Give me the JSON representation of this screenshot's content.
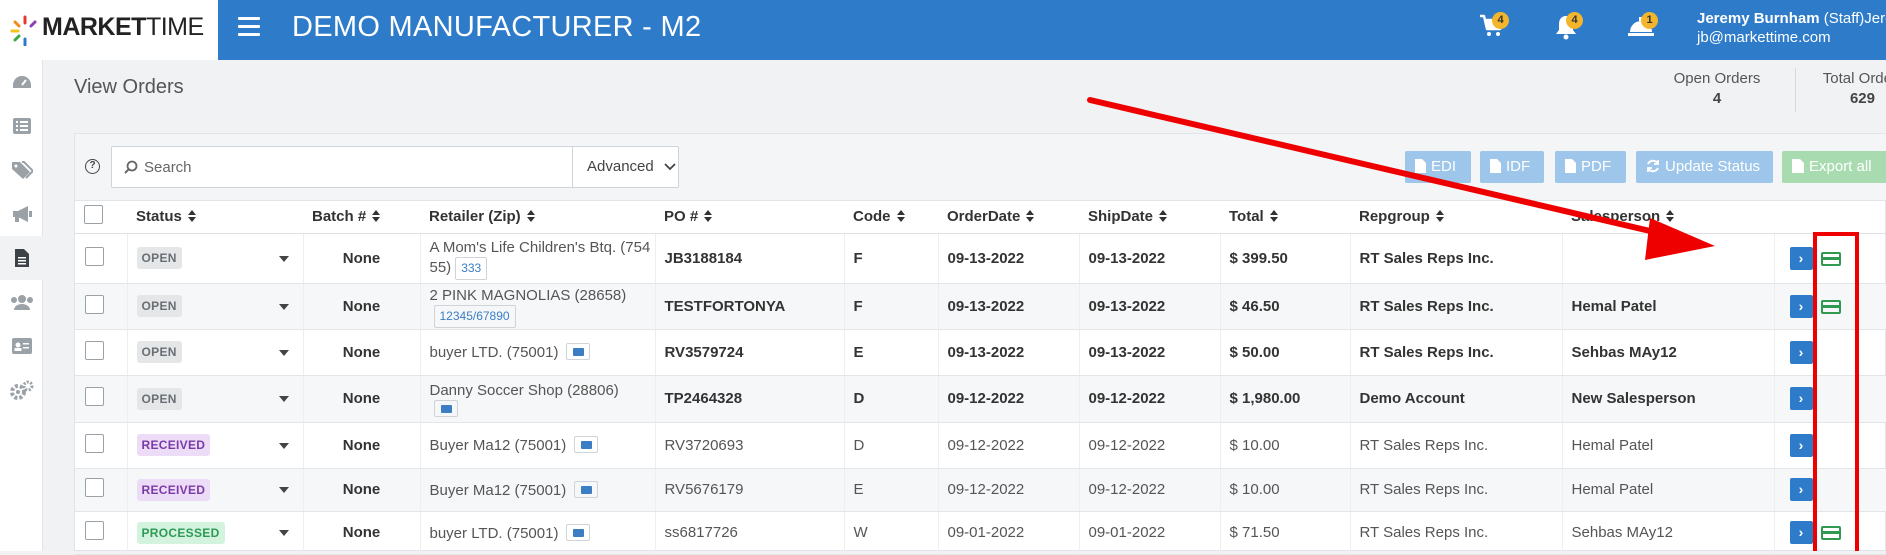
{
  "header": {
    "logo_bold": "MARKET",
    "logo_light": "TIME",
    "title": "DEMO MANUFACTURER - M2",
    "cart_badge": "4",
    "bell_badge": "4",
    "service_badge": "1",
    "user_name": "Jeremy Burnham",
    "user_role": "(Staff)Jerem",
    "user_email": "jb@markettime.com",
    "brand_color": "#2d7bc9"
  },
  "sidebar": {
    "items": [
      {
        "icon": "dashboard-icon"
      },
      {
        "icon": "list-icon"
      },
      {
        "icon": "tags-icon"
      },
      {
        "icon": "megaphone-icon"
      },
      {
        "icon": "document-icon"
      },
      {
        "icon": "users-icon"
      },
      {
        "icon": "id-card-icon"
      },
      {
        "icon": "cogs-icon"
      }
    ]
  },
  "page": {
    "title": "View Orders",
    "open_orders_label": "Open Orders",
    "open_orders_value": "4",
    "total_orders_label": "Total Orde",
    "total_orders_value": "629"
  },
  "toolbar": {
    "help": "?",
    "search_placeholder": "Search",
    "advanced_label": "Advanced",
    "edi_label": "EDI",
    "idf_label": "IDF",
    "pdf_label": "PDF",
    "update_status_label": "Update Status",
    "export_label": "Export all"
  },
  "table": {
    "columns": [
      "Status",
      "Batch #",
      "Retailer (Zip)",
      "PO #",
      "Code",
      "OrderDate",
      "ShipDate",
      "Total",
      "Repgroup",
      "Salesperson"
    ],
    "rows": [
      {
        "status": "OPEN",
        "batch": "None",
        "retailer_line1": "A Mom's Life Children's Btq. (754",
        "retailer_line2": "55)",
        "tag": "333",
        "po": "JB3188184",
        "code": "F",
        "order_date": "09-13-2022",
        "ship_date": "09-13-2022",
        "total": "$ 399.50",
        "repgroup": "RT Sales Reps Inc.",
        "salesperson": ""
      },
      {
        "status": "OPEN",
        "batch": "None",
        "retailer_line1": "2 PINK MAGNOLIAS (28658)",
        "retailer_line2": "",
        "tag": "12345/67890",
        "po": "TESTFORTONYA",
        "code": "F",
        "order_date": "09-13-2022",
        "ship_date": "09-13-2022",
        "total": "$ 46.50",
        "repgroup": "RT Sales Reps Inc.",
        "salesperson": "Hemal Patel"
      },
      {
        "status": "OPEN",
        "batch": "None",
        "retailer_line1": "buyer LTD. (75001)",
        "retailer_line2": "",
        "tag": "",
        "po": "RV3579724",
        "code": "E",
        "order_date": "09-13-2022",
        "ship_date": "09-13-2022",
        "total": "$ 50.00",
        "repgroup": "RT Sales Reps Inc.",
        "salesperson": "Sehbas MAy12"
      },
      {
        "status": "OPEN",
        "batch": "None",
        "retailer_line1": "Danny Soccer Shop (28806)",
        "retailer_line2": "",
        "tag": "",
        "po": "TP2464328",
        "code": "D",
        "order_date": "09-12-2022",
        "ship_date": "09-12-2022",
        "total": "$ 1,980.00",
        "repgroup": "Demo Account",
        "salesperson": "New Salesperson"
      },
      {
        "status": "RECEIVED",
        "batch": "None",
        "retailer_line1": "Buyer Ma12 (75001)",
        "retailer_line2": "",
        "tag": "",
        "po": "RV3720693",
        "code": "D",
        "order_date": "09-12-2022",
        "ship_date": "09-12-2022",
        "total": "$ 10.00",
        "repgroup": "RT Sales Reps Inc.",
        "salesperson": "Hemal Patel"
      },
      {
        "status": "RECEIVED",
        "batch": "None",
        "retailer_line1": "Buyer Ma12 (75001)",
        "retailer_line2": "",
        "tag": "",
        "po": "RV5676179",
        "code": "E",
        "order_date": "09-12-2022",
        "ship_date": "09-12-2022",
        "total": "$ 10.00",
        "repgroup": "RT Sales Reps Inc.",
        "salesperson": "Hemal Patel"
      },
      {
        "status": "PROCESSED",
        "batch": "None",
        "retailer_line1": "buyer LTD. (75001)",
        "retailer_line2": "",
        "tag": "",
        "po": "ss6817726",
        "code": "W",
        "order_date": "09-01-2022",
        "ship_date": "09-01-2022",
        "total": "$ 71.50",
        "repgroup": "RT Sales Reps Inc.",
        "salesperson": "Sehbas MAy12"
      }
    ]
  },
  "annotation_color": "#e00000"
}
